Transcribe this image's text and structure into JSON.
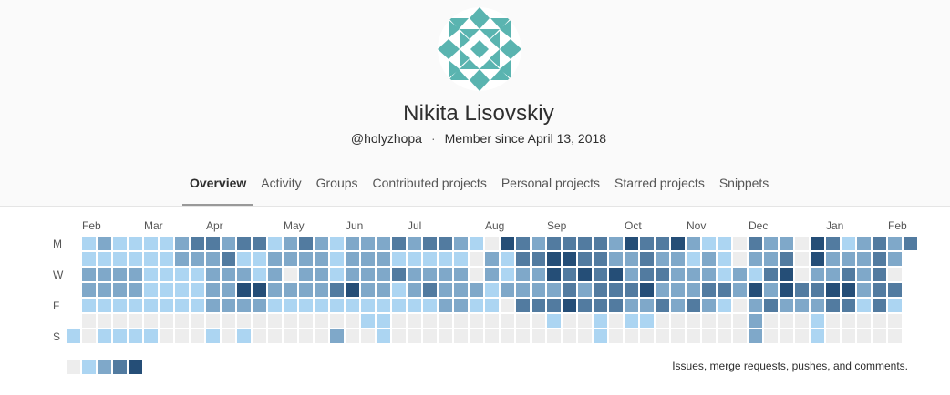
{
  "profile": {
    "name": "Nikita Lisovskiy",
    "username": "@holyzhopa",
    "separator": "·",
    "member_since": "Member since April 13, 2018"
  },
  "tabs": [
    {
      "label": "Overview",
      "active": true
    },
    {
      "label": "Activity",
      "active": false
    },
    {
      "label": "Groups",
      "active": false
    },
    {
      "label": "Contributed projects",
      "active": false
    },
    {
      "label": "Personal projects",
      "active": false
    },
    {
      "label": "Starred projects",
      "active": false
    },
    {
      "label": "Snippets",
      "active": false
    }
  ],
  "calendar": {
    "months": [
      {
        "label": "Feb",
        "week": 1
      },
      {
        "label": "Mar",
        "week": 5
      },
      {
        "label": "Apr",
        "week": 9
      },
      {
        "label": "May",
        "week": 14
      },
      {
        "label": "Jun",
        "week": 18
      },
      {
        "label": "Jul",
        "week": 22
      },
      {
        "label": "Aug",
        "week": 27
      },
      {
        "label": "Sep",
        "week": 31
      },
      {
        "label": "Oct",
        "week": 36
      },
      {
        "label": "Nov",
        "week": 40
      },
      {
        "label": "Dec",
        "week": 44
      },
      {
        "label": "Jan",
        "week": 49
      },
      {
        "label": "Feb",
        "week": 53
      }
    ],
    "day_labels": [
      {
        "label": "M",
        "row": 0
      },
      {
        "label": "W",
        "row": 2
      },
      {
        "label": "F",
        "row": 4
      },
      {
        "label": "S",
        "row": 6
      }
    ],
    "colors": [
      "#ededed",
      "#acd5f2",
      "#7fa8c9",
      "#527ba0",
      "#254e77"
    ],
    "levels": [
      "0121111233233123212223233210432333324334211032204312323",
      "0111111222311222212221111102133443322322121022304222321",
      "0222211112221202212223222202122434342332221213402232301",
      "0222211112244222234221232221222232333422233242433442332",
      "0111111112222111111111112211033343332232321023222331311",
      "0000000000000000000110000000000100101100000020001000000",
      "1011110001010000020010000000000000100000000020001000000"
    ],
    "empty_leading_cells": 6,
    "empty_trailing_cells": 6
  },
  "legend": {
    "text": "Issues, merge requests, pushes, and comments."
  }
}
